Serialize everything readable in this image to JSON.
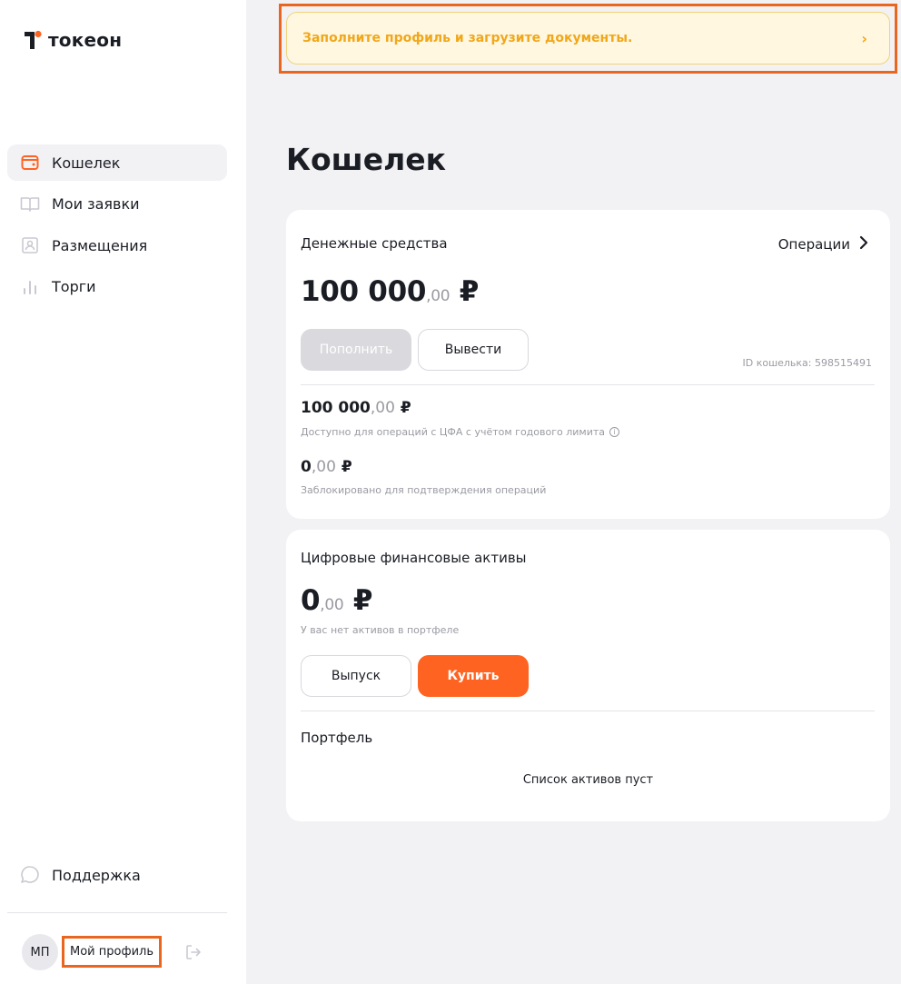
{
  "brand": {
    "name": "токеон",
    "accent": "#ff6321"
  },
  "sidebar": {
    "items": [
      {
        "label": "Кошелек",
        "icon": "wallet-icon",
        "active": true
      },
      {
        "label": "Мои заявки",
        "icon": "book-icon",
        "active": false
      },
      {
        "label": "Размещения",
        "icon": "placement-icon",
        "active": false
      },
      {
        "label": "Торги",
        "icon": "chart-bars-icon",
        "active": false
      }
    ],
    "support_label": "Поддержка",
    "avatar_initials": "МП",
    "profile_label": "Мой профиль"
  },
  "banner": {
    "text": "Заполните профиль и загрузите документы.",
    "chevron": "›"
  },
  "page": {
    "title": "Кошелек"
  },
  "funds": {
    "title": "Денежные средства",
    "operations_label": "Операции",
    "total_main": "100 000",
    "total_cents": ",00",
    "currency": "₽",
    "topup_label": "Пополнить",
    "withdraw_label": "Вывести",
    "wallet_id": "ID кошелька: 598515491",
    "available_main": "100 000",
    "available_cents": ",00",
    "available_hint": "Доступно для операций с ЦФА с учётом годового лимита",
    "blocked_main": "0",
    "blocked_cents": ",00",
    "blocked_hint": "Заблокировано для подтверждения операций"
  },
  "dfa": {
    "title": "Цифровые финансовые активы",
    "total_main": "0",
    "total_cents": ",00",
    "currency": "₽",
    "empty_hint": "У вас нет активов в портфеле",
    "issue_label": "Выпуск",
    "buy_label": "Купить",
    "portfolio_title": "Портфель",
    "portfolio_empty": "Список активов пуст"
  }
}
